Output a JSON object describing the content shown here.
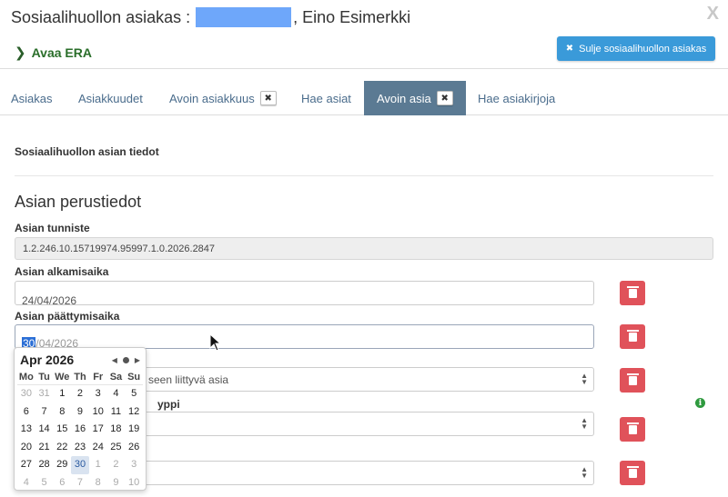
{
  "header": {
    "title_prefix": "Sosiaalihuollon asiakas :",
    "title_name": ", Eino Esimerkki",
    "era_link": "Avaa ERA",
    "close_client_button": "Sulje sosiaalihuollon asiakas",
    "close_icon": "close-icon"
  },
  "tabs": [
    {
      "label": "Asiakas"
    },
    {
      "label": "Asiakkuudet"
    },
    {
      "label": "Avoin asiakkuus"
    },
    {
      "label": "Hae asiat"
    },
    {
      "label": "Avoin asia"
    },
    {
      "label": "Hae asiakirjoja"
    }
  ],
  "section_title": "Sosiaalihuollon asian tiedot",
  "basic_info_heading": "Asian perustiedot",
  "fields": {
    "id_label": "Asian tunniste",
    "id_value": "1.2.246.10.15719974.95997.1.0.2026.2847",
    "start_label": "Asian alkamisaika",
    "start_value": "24/04/2026",
    "end_label": "Asian päättymisaika",
    "end_day": "30",
    "end_rest_sep": "/",
    "end_month": "04",
    "end_year": "2026",
    "select1_value": "seen liittyvä asia",
    "select2_label_fragment": "yppi"
  },
  "calendar": {
    "month_label": "Apr 2026",
    "weekdays": [
      "Mo",
      "Tu",
      "We",
      "Th",
      "Fr",
      "Sa",
      "Su"
    ],
    "weeks": [
      [
        "30",
        "31",
        "1",
        "2",
        "3",
        "4",
        "5"
      ],
      [
        "6",
        "7",
        "8",
        "9",
        "10",
        "11",
        "12"
      ],
      [
        "13",
        "14",
        "15",
        "16",
        "17",
        "18",
        "19"
      ],
      [
        "20",
        "21",
        "22",
        "23",
        "24",
        "25",
        "26"
      ],
      [
        "27",
        "28",
        "29",
        "30",
        "1",
        "2",
        "3"
      ],
      [
        "4",
        "5",
        "6",
        "7",
        "8",
        "9",
        "10"
      ]
    ]
  },
  "colors": {
    "primary_button": "#3a9ad9",
    "active_tab": "#5b7a93",
    "delete_button": "#e0525a",
    "link_green": "#2a6e2a"
  }
}
